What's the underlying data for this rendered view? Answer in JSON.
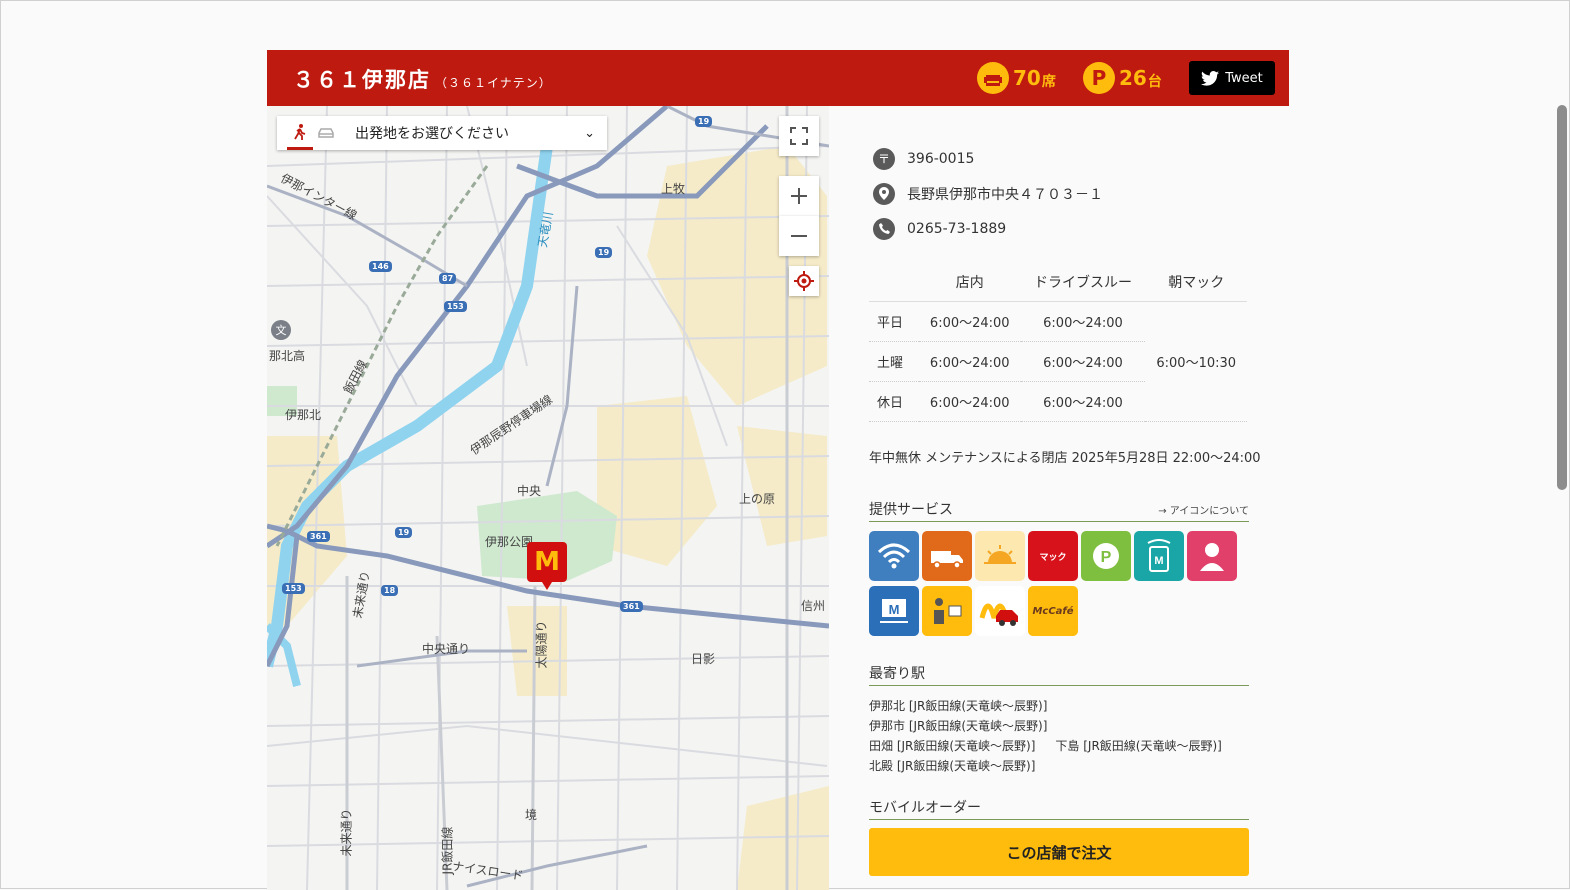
{
  "header": {
    "store_name": "３６１伊那店",
    "store_kana": "（３６１イナテン）",
    "seats_value": "70",
    "seats_unit": "席",
    "parking_value": "26",
    "parking_unit": "台",
    "parking_letter": "P",
    "tweet_label": "Tweet"
  },
  "map": {
    "origin_placeholder": "出発地をお選びください",
    "labels": {
      "ina_interchange_line": "伊那インター線",
      "kamimaki": "上牧",
      "tenryu_river": "天竜川",
      "ina_kita_high": "那北高",
      "iida_line": "飯田線",
      "inakita_station": "伊那北",
      "ina_tatsuno_parking_line": "伊那辰野停車場線",
      "chuo": "中央",
      "kaminohara": "上の原",
      "ina_park": "伊那公園",
      "mirai_dori": "未来通り",
      "chuo_dori": "中央通り",
      "taiyo_dori": "太陽通り",
      "shinshu": "信州",
      "hikage": "日影",
      "sakai": "境",
      "mirai_dori_2": "未来通り",
      "jr_iida_line": "JR飯田線",
      "nice_road": "ナイスロード"
    },
    "routes": {
      "r19a": "19",
      "r19b": "19",
      "r19c": "19",
      "r146": "146",
      "r87": "87",
      "r153a": "153",
      "r153b": "153",
      "r361a": "361",
      "r361b": "361",
      "r18": "18"
    }
  },
  "info": {
    "postal_code": "396-0015",
    "address": "長野県伊那市中央４７０３－１",
    "phone": "0265-73-1889"
  },
  "hours": {
    "headers": [
      "店内",
      "ドライブスルー",
      "朝マック"
    ],
    "rows": [
      {
        "day": "平日",
        "store": "6:00～24:00",
        "drive": "6:00～24:00"
      },
      {
        "day": "土曜",
        "store": "6:00～24:00",
        "drive": "6:00～24:00"
      },
      {
        "day": "休日",
        "store": "6:00～24:00",
        "drive": "6:00～24:00"
      }
    ],
    "breakfast": "6:00～10:30",
    "note": "年中無休 メンテナンスによる閉店 2025年5月28日 22:00～24:00"
  },
  "services": {
    "title": "提供サービス",
    "about_link": "アイコンについて",
    "icons": [
      {
        "name": "wifi-icon",
        "color": "#3f7fbf",
        "glyph": "≋"
      },
      {
        "name": "delivery-icon",
        "color": "#e0691a",
        "glyph": "🚚"
      },
      {
        "name": "breakfast-icon",
        "color": "#fde9b0",
        "glyph": "☀"
      },
      {
        "name": "mac-adventure-icon",
        "color": "#d8121b",
        "glyph": "マック"
      },
      {
        "name": "parking-service-icon",
        "color": "#7fbf3f",
        "glyph": "P"
      },
      {
        "name": "mobile-order-icon",
        "color": "#1aa6a6",
        "glyph": "M"
      },
      {
        "name": "crew-icon",
        "color": "#e0406a",
        "glyph": "●"
      },
      {
        "name": "menu-board-icon",
        "color": "#2a6fb8",
        "glyph": "M"
      },
      {
        "name": "table-delivery-icon",
        "color": "#ffbc0d",
        "glyph": "▣"
      },
      {
        "name": "drive-thru-icon",
        "color": "#ffffff",
        "glyph": "M"
      },
      {
        "name": "mccafe-icon",
        "color": "#ffbc0d",
        "glyph": "McCafé"
      }
    ]
  },
  "stations": {
    "title": "最寄り駅",
    "list": [
      "伊那北 [JR飯田線(天竜峡～辰野)]",
      "伊那市 [JR飯田線(天竜峡～辰野)]",
      "田畑 [JR飯田線(天竜峡～辰野)]",
      "下島 [JR飯田線(天竜峡～辰野)]",
      "北殿 [JR飯田線(天竜峡～辰野)]"
    ]
  },
  "mobile_order": {
    "title": "モバイルオーダー",
    "button_label": "この店舗で注文"
  },
  "colors": {
    "header_red": "#bf1a10",
    "mc_yellow": "#ffbc0d",
    "river": "#8fd3ef"
  }
}
